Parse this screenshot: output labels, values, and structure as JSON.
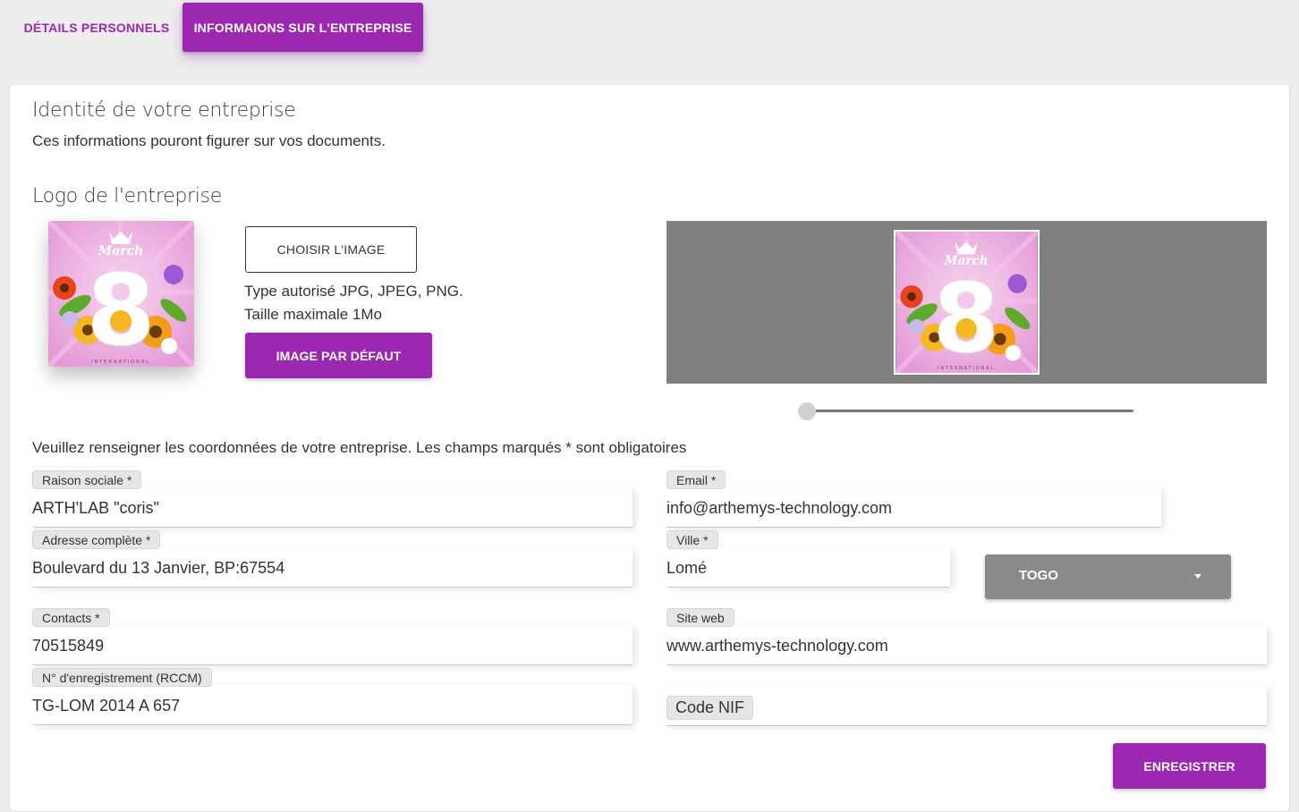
{
  "tabs": {
    "personal": "DÉTAILS PERSONNELS",
    "company": "INFORMAIONS SUR L'ENTREPRISE"
  },
  "identity": {
    "title": "Identité de votre entreprise",
    "subtitle": "Ces informations pouront figurer sur vos documents."
  },
  "logo": {
    "title": "Logo de l'entreprise",
    "choose_button": "CHOISIR L'IMAGE",
    "hint_types": "Type autorisé JPG, JPEG, PNG.",
    "hint_size": "Taille maximale 1Mo",
    "default_button": "IMAGE PAR DÉFAUT",
    "image_text": "March",
    "image_number": "8",
    "image_footer": "INTERNATIONAL",
    "zoom_slider_level": 0
  },
  "form": {
    "intro": "Veuillez renseigner les coordonnées de votre entreprise. Les champs marqués * sont obligatoires",
    "raison_sociale": {
      "label": "Raison sociale *",
      "value": "ARTH'LAB \"coris\""
    },
    "email": {
      "label": "Email *",
      "value": "info@arthemys-technology.com"
    },
    "adresse": {
      "label": "Adresse complète *",
      "value": "Boulevard du 13 Janvier, BP:67554"
    },
    "ville": {
      "label": "Ville *",
      "value": "Lomé"
    },
    "pays": {
      "value": "TOGO"
    },
    "contacts": {
      "label": "Contacts *",
      "value": "70515849"
    },
    "site_web": {
      "label": "Site web",
      "value": "www.arthemys-technology.com"
    },
    "rccm": {
      "label": "N° d'enregistrement (RCCM)",
      "value": "TG-LOM 2014 A 657"
    },
    "nif": {
      "placeholder": "Code NIF"
    },
    "save_button": "ENREGISTRER"
  },
  "colors": {
    "accent": "#9c27b0",
    "select_bg": "#8a8a8a",
    "cropper_bg": "#808080"
  }
}
